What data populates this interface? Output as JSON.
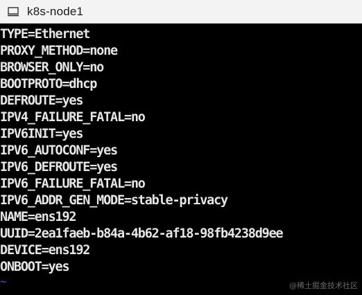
{
  "window": {
    "title": "k8s-node1",
    "title_icon": "terminal-window-icon"
  },
  "terminal": {
    "lines": [
      "TYPE=Ethernet",
      "PROXY_METHOD=none",
      "BROWSER_ONLY=no",
      "BOOTPROTO=dhcp",
      "DEFROUTE=yes",
      "IPV4_FAILURE_FATAL=no",
      "IPV6INIT=yes",
      "IPV6_AUTOCONF=yes",
      "IPV6_DEFROUTE=yes",
      "IPV6_FAILURE_FATAL=no",
      "IPV6_ADDR_GEN_MODE=stable-privacy",
      "NAME=ens192",
      "UUID=2ea1faeb-b84a-4b62-af18-98fb4238d9ee",
      "DEVICE=ens192",
      "ONBOOT=yes"
    ],
    "empty_line_marker": "~",
    "text_color": "#e6e6e6",
    "tilde_color": "#3a5bd6",
    "background": "#000000"
  },
  "watermark": {
    "text": "@稀土掘金技术社区"
  }
}
